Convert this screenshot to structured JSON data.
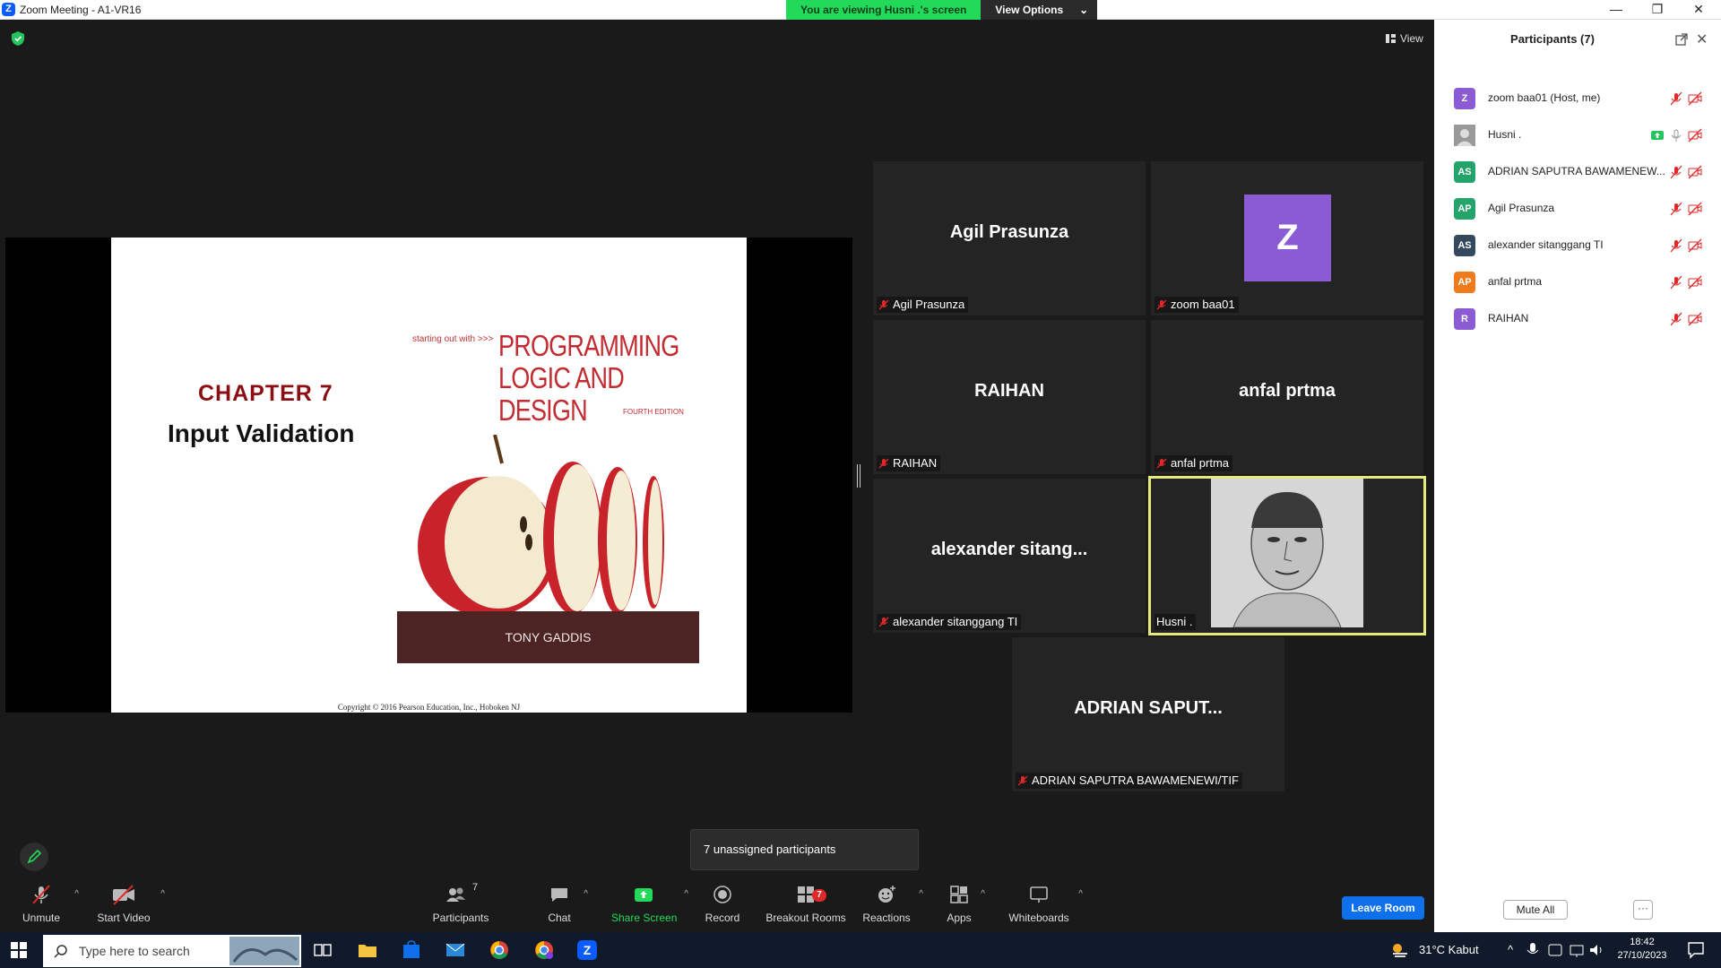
{
  "window": {
    "title": "Zoom Meeting - A1-VR16",
    "viewing_banner": "You are viewing Husni .'s screen",
    "view_options": "View Options",
    "view_button": "View"
  },
  "shared_slide": {
    "chapter": "CHAPTER 7",
    "subtitle": "Input Validation",
    "book_tagline": "starting out with >>>",
    "book_title_line1": "PROGRAMMING",
    "book_title_line2": "LOGIC AND DESIGN",
    "edition": "FOURTH EDITION",
    "author": "TONY GADDIS",
    "copyright": "Copyright © 2016 Pearson Education, Inc., Hoboken NJ"
  },
  "tiles": [
    {
      "display": "Agil Prasunza",
      "label": "Agil Prasunza"
    },
    {
      "display": "Z",
      "label": "zoom baa01"
    },
    {
      "display": "RAIHAN",
      "label": "RAIHAN"
    },
    {
      "display": "anfal prtma",
      "label": "anfal prtma"
    },
    {
      "display": "alexander  sitang...",
      "label": "alexander sitanggang TI"
    },
    {
      "display": "",
      "label": "Husni ."
    },
    {
      "display": "ADRIAN  SAPUT...",
      "label": "ADRIAN SAPUTRA BAWAMENEWI/TIF"
    }
  ],
  "unassigned": "7 unassigned participants",
  "toolbar": {
    "unmute": "Unmute",
    "start_video": "Start Video",
    "participants": "Participants",
    "participants_count": "7",
    "chat": "Chat",
    "share_screen": "Share Screen",
    "record": "Record",
    "breakout_rooms": "Breakout Rooms",
    "breakout_badge": "7",
    "reactions": "Reactions",
    "apps": "Apps",
    "whiteboards": "Whiteboards",
    "leave_room": "Leave Room"
  },
  "panel": {
    "title": "Participants (7)",
    "participants": [
      {
        "initials": "Z",
        "name": "zoom baa01 (Host, me)",
        "color": "#8b5bd3"
      },
      {
        "initials": "",
        "name": "Husni .",
        "color": "#888888"
      },
      {
        "initials": "AS",
        "name": "ADRIAN SAPUTRA BAWAMENEW...",
        "color": "#24a36a"
      },
      {
        "initials": "AP",
        "name": "Agil Prasunza",
        "color": "#24a36a"
      },
      {
        "initials": "AS",
        "name": "alexander sitanggang TI",
        "color": "#34495e"
      },
      {
        "initials": "AP",
        "name": "anfal prtma",
        "color": "#f07b1c"
      },
      {
        "initials": "R",
        "name": "RAIHAN",
        "color": "#8b5bd3"
      }
    ],
    "mute_all": "Mute All",
    "more": "···"
  },
  "taskbar": {
    "search_placeholder": "Type here to search",
    "weather": "31°C  Kabut",
    "time": "18:42",
    "date": "27/10/2023"
  },
  "colors": {
    "banner_green": "#23d959",
    "leave_blue": "#0e71eb",
    "active_speaker": "#e7e97a",
    "mute_red": "#e02828"
  }
}
